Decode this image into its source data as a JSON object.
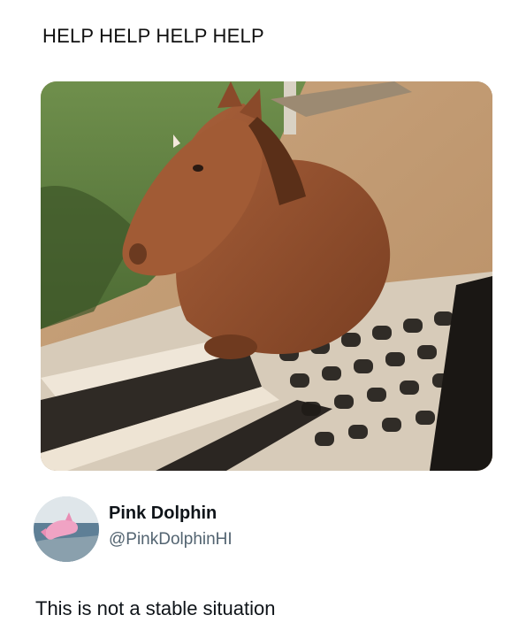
{
  "quoted_post": {
    "text": "HELP HELP HELP HELP"
  },
  "media": {
    "subject": "horse standing in a cattle grid, legs through the bars"
  },
  "author": {
    "display_name": "Pink Dolphin",
    "handle": "@PinkDolphinHI",
    "avatar_icon": "pink-dolphin-avatar"
  },
  "post": {
    "text": "This is not a stable situation"
  },
  "colors": {
    "text_primary": "#0f1419",
    "text_secondary": "#536471",
    "background": "#ffffff"
  }
}
